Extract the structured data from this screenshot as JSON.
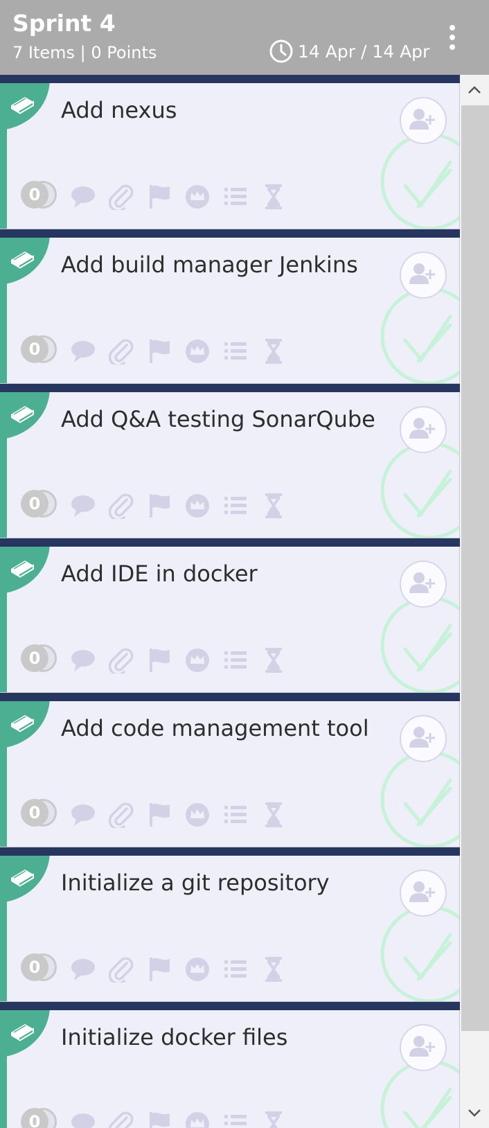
{
  "header": {
    "title": "Sprint 4",
    "subtitle": "7 Items | 0 Points",
    "date_range": "14 Apr / 14 Apr",
    "clock_icon": "clock-icon",
    "menu_icon": "more-vertical-icon"
  },
  "cards": [
    {
      "title": "Add nexus",
      "count": "0"
    },
    {
      "title": "Add build manager Jenkins",
      "count": "0"
    },
    {
      "title": "Add Q&A testing SonarQube",
      "count": "0"
    },
    {
      "title": "Add IDE in docker",
      "count": "0"
    },
    {
      "title": "Add code management tool",
      "count": "0"
    },
    {
      "title": "Initialize a git repository",
      "count": "0"
    },
    {
      "title": "Initialize docker files",
      "count": "0"
    }
  ],
  "card_icons": [
    "comment-icon",
    "attachment-icon",
    "flag-icon",
    "crown-icon",
    "list-icon",
    "hourglass-icon"
  ],
  "colors": {
    "header_bg": "#ababab",
    "card_top_bar": "#26365f",
    "card_bg": "#efeff9",
    "story_accent": "#4daf92",
    "check_color": "#c6f2d8",
    "icon_muted": "#d3d1e6"
  }
}
